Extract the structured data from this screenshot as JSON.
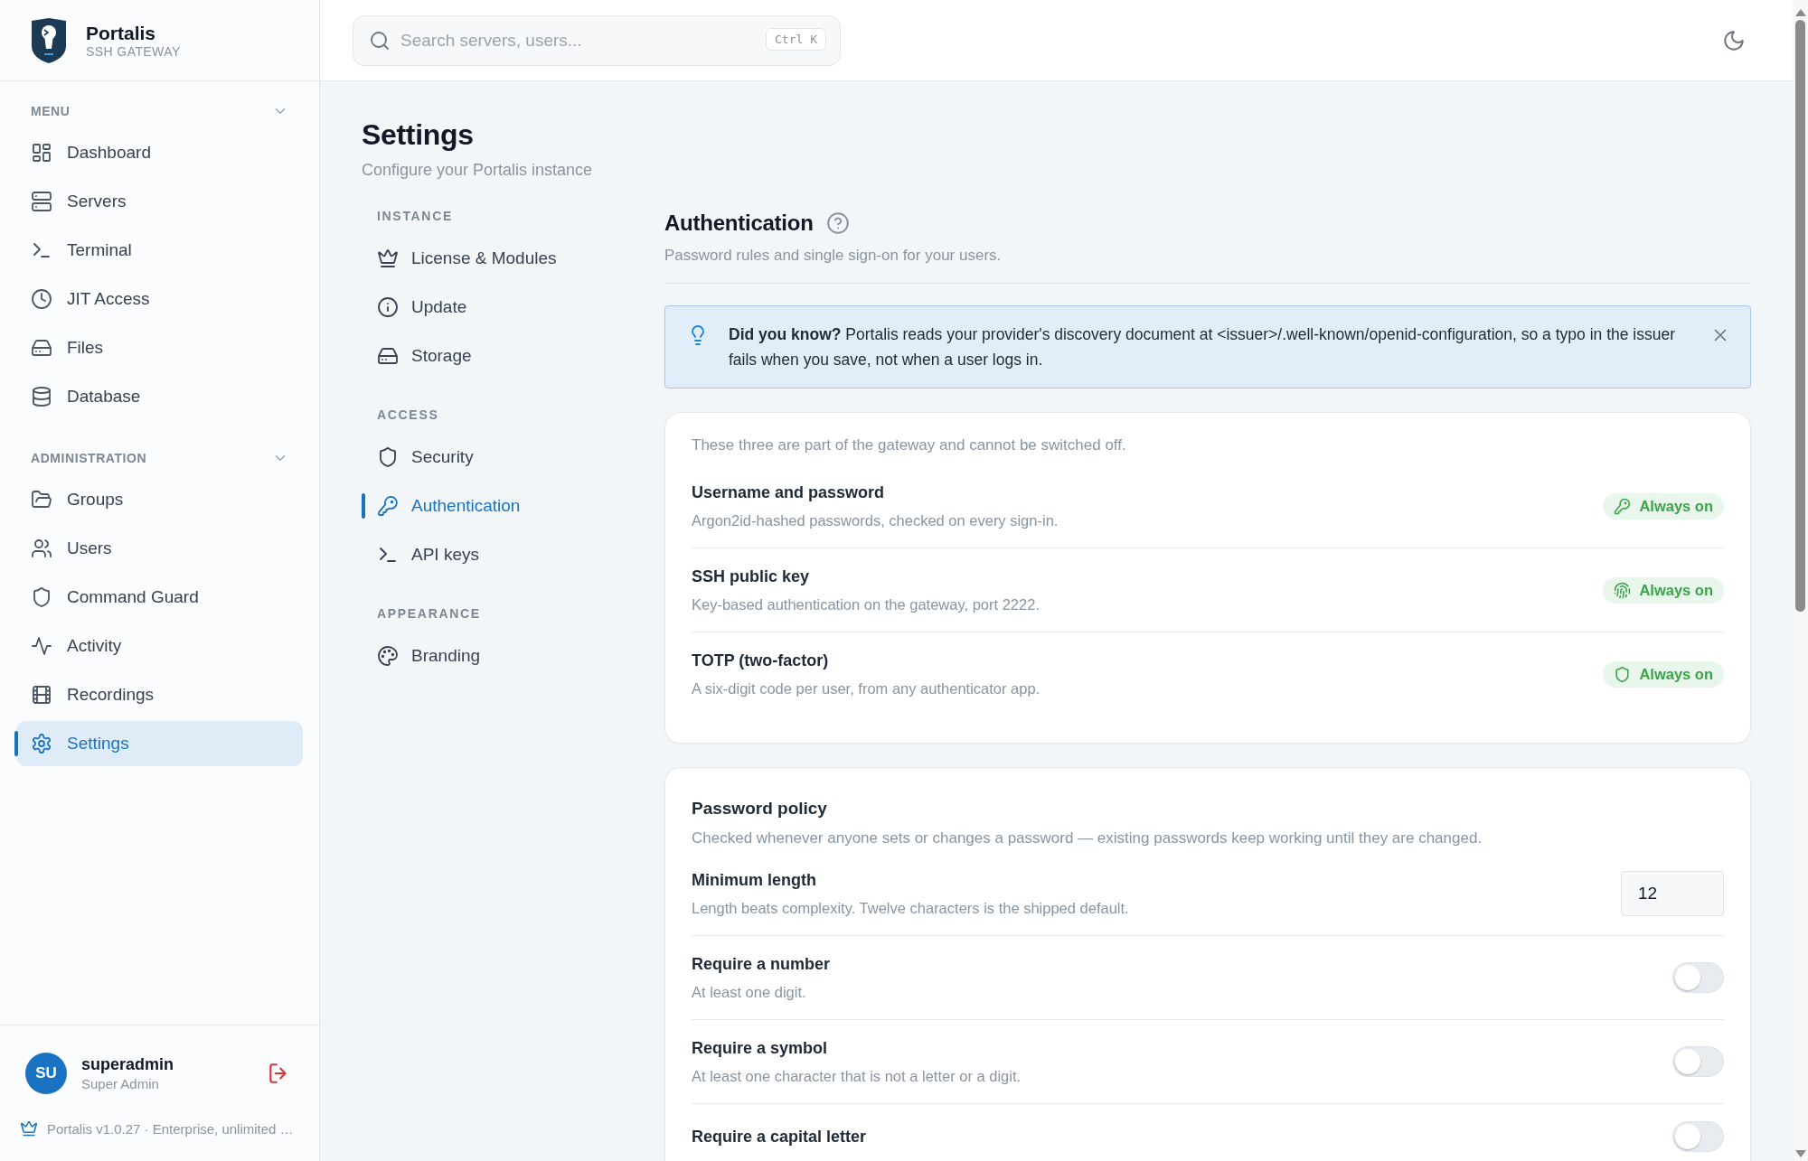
{
  "brand": {
    "name": "Portalis",
    "tagline": "SSH GATEWAY"
  },
  "sidebar": {
    "sections": [
      {
        "title": "MENU",
        "expanded": true,
        "items": [
          {
            "label": "Dashboard",
            "selected": false
          },
          {
            "label": "Servers",
            "selected": false
          },
          {
            "label": "Terminal",
            "selected": false
          },
          {
            "label": "JIT Access",
            "selected": false
          },
          {
            "label": "Files",
            "selected": false
          },
          {
            "label": "Database",
            "selected": false
          }
        ]
      },
      {
        "title": "ADMINISTRATION",
        "expanded": true,
        "items": [
          {
            "label": "Groups",
            "selected": false
          },
          {
            "label": "Users",
            "selected": false
          },
          {
            "label": "Command Guard",
            "selected": false
          },
          {
            "label": "Activity",
            "selected": false
          },
          {
            "label": "Recordings",
            "selected": false
          },
          {
            "label": "Settings",
            "selected": true
          }
        ]
      }
    ]
  },
  "user": {
    "initials": "SU",
    "name": "superadmin",
    "role": "Super Admin"
  },
  "version": "Portalis v1.0.27 · Enterprise, unlimited …",
  "search": {
    "placeholder": "Search servers, users...",
    "shortcut": "Ctrl K"
  },
  "page": {
    "title": "Settings",
    "subtitle": "Configure your Portalis instance"
  },
  "settings_nav": [
    {
      "title": "INSTANCE",
      "items": [
        {
          "label": "License & Modules",
          "selected": false
        },
        {
          "label": "Update",
          "selected": false
        },
        {
          "label": "Storage",
          "selected": false
        }
      ]
    },
    {
      "title": "ACCESS",
      "items": [
        {
          "label": "Security",
          "selected": false
        },
        {
          "label": "Authentication",
          "selected": true
        },
        {
          "label": "API keys",
          "selected": false
        }
      ]
    },
    {
      "title": "APPEARANCE",
      "items": [
        {
          "label": "Branding",
          "selected": false
        }
      ]
    }
  ],
  "section": {
    "title": "Authentication",
    "subtitle": "Password rules and single sign-on for your users."
  },
  "tip": {
    "text": "**Did you know?** Portalis reads your provider's discovery document at <issuer>/.well-known/openid-configuration, so a typo in the issuer fails when you save, not when a user logs in."
  },
  "builtin": {
    "intro": "These three are part of the gateway and cannot be switched off.",
    "methods": [
      {
        "title": "Username and password",
        "description": "Argon2id-hashed passwords, checked on every sign-in.",
        "badge": "Always on"
      },
      {
        "title": "SSH public key",
        "description": "Key-based authentication on the gateway, port 2222.",
        "badge": "Always on"
      },
      {
        "title": "TOTP (two-factor)",
        "description": "A six-digit code per user, from any authenticator app.",
        "badge": "Always on"
      }
    ]
  },
  "password_policy": {
    "title": "Password policy",
    "description": "Checked whenever anyone sets or changes a password — existing passwords keep working until they are changed.",
    "settings": [
      {
        "kind": "number",
        "title": "Minimum length",
        "description": "Length beats complexity. Twelve characters is the shipped default.",
        "value": "12"
      },
      {
        "kind": "toggle",
        "title": "Require a number",
        "description": "At least one digit.",
        "on": false
      },
      {
        "kind": "toggle",
        "title": "Require a symbol",
        "description": "At least one character that is not a letter or a digit.",
        "on": false
      },
      {
        "kind": "toggle",
        "title": "Require a capital letter",
        "on": false
      }
    ]
  }
}
